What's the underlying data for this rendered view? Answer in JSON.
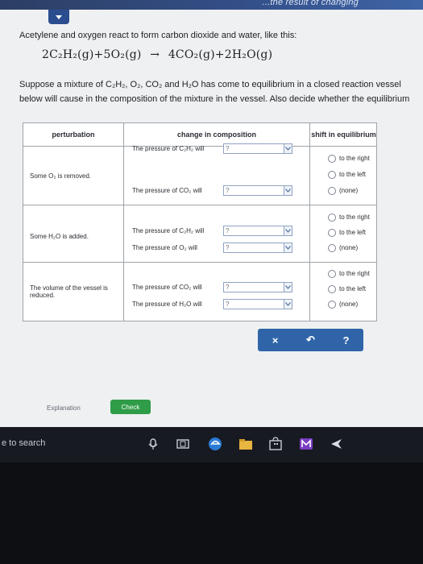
{
  "header": {
    "title": "...the result of changing"
  },
  "question": {
    "prompt": "Acetylene and oxygen react to form carbon dioxide and water, like this:",
    "equation": {
      "left": "2C₂H₂(g)+5O₂(g)",
      "arrow": "→",
      "right": "4CO₂(g)+2H₂O(g)"
    },
    "paragraph_line1": "Suppose a mixture of C₂H₂, O₂, CO₂ and H₂O has come to equilibrium in a closed reaction vessel",
    "paragraph_line2": "below will cause in the composition of the mixture in the vessel. Also decide whether the equilibrium"
  },
  "table": {
    "headers": [
      "perturbation",
      "change in composition",
      "shift in equilibrium"
    ],
    "rows": [
      {
        "perturbation": "Some O₂ is removed.",
        "changes": [
          {
            "label": "The pressure of C₂H₂ will",
            "value": "?"
          },
          {
            "label": "The pressure of CO₂ will",
            "value": "?"
          }
        ],
        "options": [
          "to the right",
          "to the left",
          "(none)"
        ]
      },
      {
        "perturbation": "Some H₂O is added.",
        "changes": [
          {
            "label": "The pressure of C₂H₂ will",
            "value": "?"
          },
          {
            "label": "The pressure of O₂ will",
            "value": "?"
          }
        ],
        "options": [
          "to the right",
          "to the left",
          "(none)"
        ]
      },
      {
        "perturbation": "The volume of the vessel is reduced.",
        "changes": [
          {
            "label": "The pressure of CO₂ will",
            "value": "?"
          },
          {
            "label": "The pressure of H₂O will",
            "value": "?"
          }
        ],
        "options": [
          "to the right",
          "to the left",
          "(none)"
        ]
      }
    ]
  },
  "actions": {
    "clear": "×",
    "undo": "↶",
    "help": "?"
  },
  "footer": {
    "explanation": "Explanation",
    "check": "Check"
  },
  "taskbar": {
    "search": "e to search"
  },
  "colors": {
    "accent": "#2f65a8",
    "check": "#2f9c48",
    "header": "#2c3e63"
  }
}
